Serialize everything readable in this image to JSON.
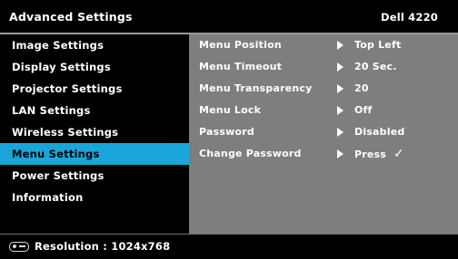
{
  "header": {
    "title": "Advanced Settings",
    "model": "Dell 4220"
  },
  "menu": {
    "items": [
      {
        "label": "Image Settings"
      },
      {
        "label": "Display Settings"
      },
      {
        "label": "Projector Settings"
      },
      {
        "label": "LAN Settings"
      },
      {
        "label": "Wireless Settings"
      },
      {
        "label": "Menu Settings",
        "selected": true
      },
      {
        "label": "Power Settings"
      },
      {
        "label": "Information"
      }
    ]
  },
  "content": {
    "rows": [
      {
        "label": "Menu Position",
        "value": "Top Left"
      },
      {
        "label": "Menu Timeout",
        "value": "20 Sec."
      },
      {
        "label": "Menu Transparency",
        "value": "20"
      },
      {
        "label": "Menu Lock",
        "value": "Off"
      },
      {
        "label": "Password",
        "value": "Disabled"
      },
      {
        "label": "Change Password",
        "value": "Press",
        "check": "✓"
      }
    ]
  },
  "footer": {
    "icon": "projector-icon",
    "resolution": "Resolution : 1024x768"
  },
  "colors": {
    "selected": "#1aa6d8",
    "panel": "#7e7e7e",
    "background": "#000000"
  }
}
